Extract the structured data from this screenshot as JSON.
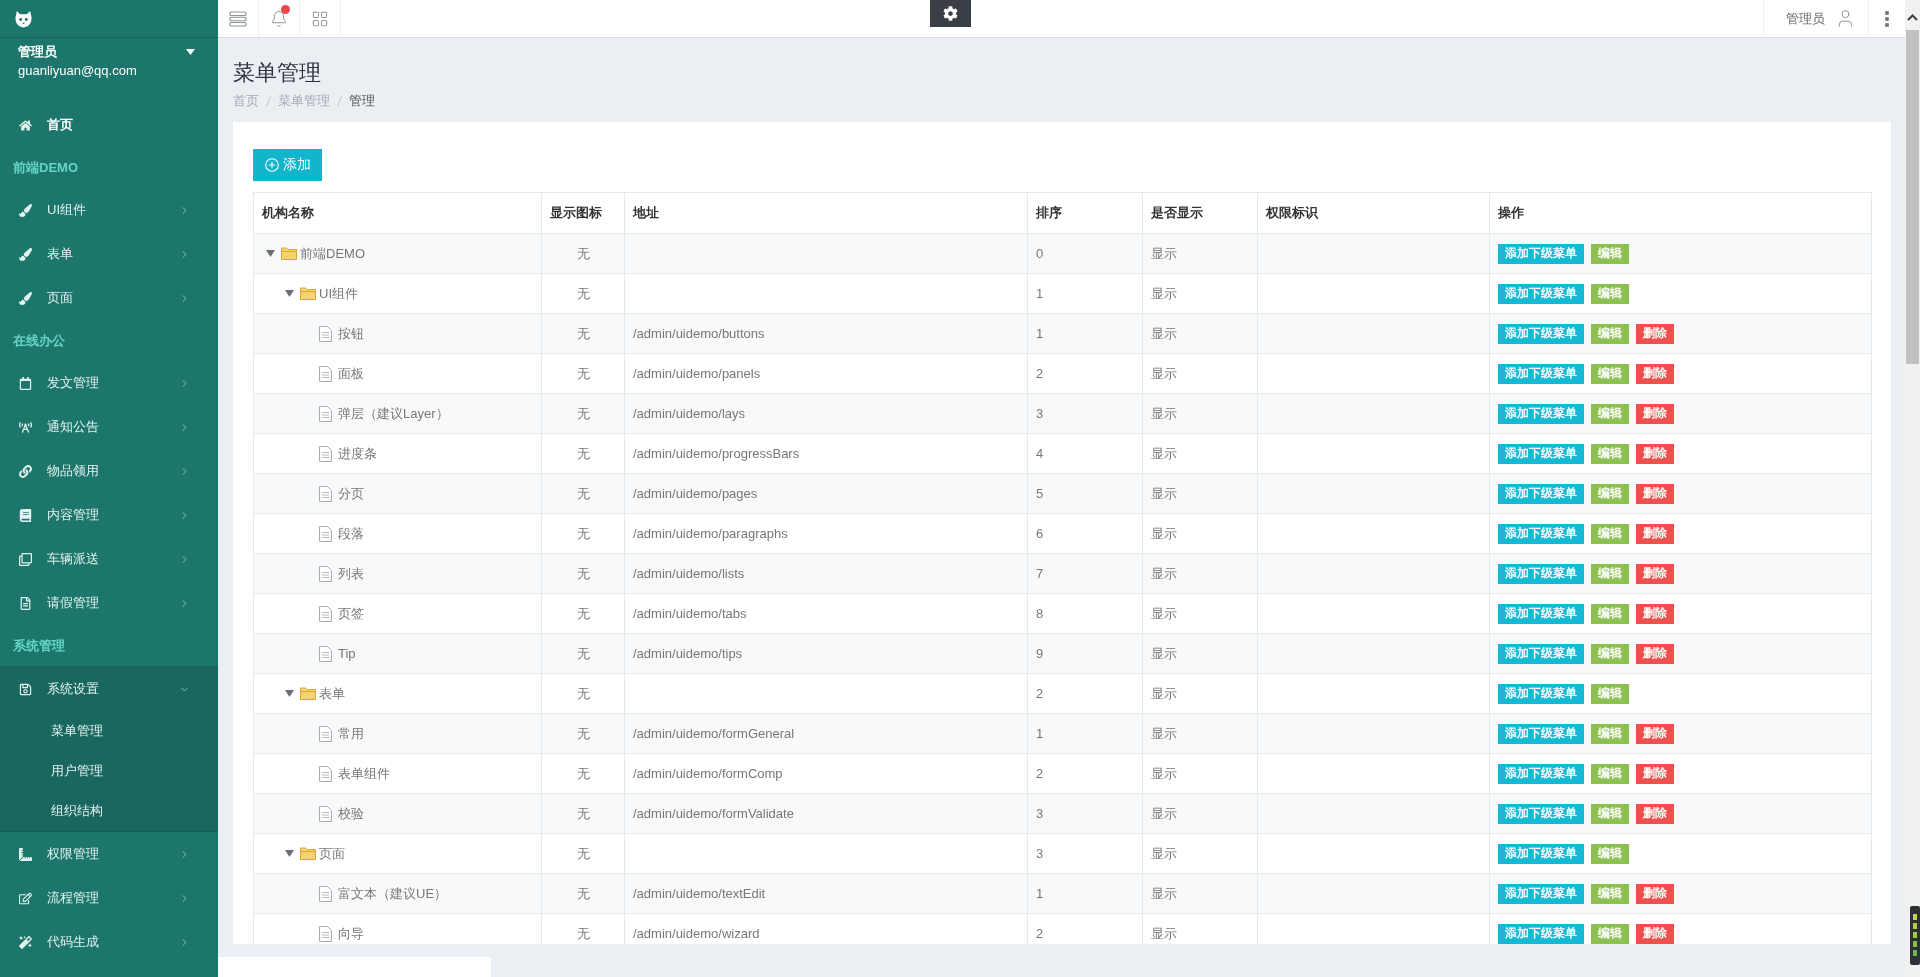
{
  "sidebar": {
    "user": {
      "name": "管理员",
      "email": "guanliyuan@qq.com"
    },
    "nav": [
      {
        "kind": "link",
        "label": "首页"
      },
      {
        "kind": "section",
        "label": "前端DEMO"
      },
      {
        "kind": "menu",
        "label": "UI组件",
        "expanded": false
      },
      {
        "kind": "menu",
        "label": "表单",
        "expanded": false
      },
      {
        "kind": "menu",
        "label": "页面",
        "expanded": false
      },
      {
        "kind": "section",
        "label": "在线办公"
      },
      {
        "kind": "menu",
        "label": "发文管理",
        "expanded": false
      },
      {
        "kind": "menu",
        "label": "通知公告",
        "expanded": false
      },
      {
        "kind": "menu",
        "label": "物品领用",
        "expanded": false
      },
      {
        "kind": "menu",
        "label": "内容管理",
        "expanded": false
      },
      {
        "kind": "menu",
        "label": "车辆派送",
        "expanded": false
      },
      {
        "kind": "menu",
        "label": "请假管理",
        "expanded": false
      },
      {
        "kind": "section",
        "label": "系统管理"
      },
      {
        "kind": "menu",
        "label": "系统设置",
        "expanded": true,
        "children": [
          {
            "label": "菜单管理"
          },
          {
            "label": "用户管理"
          },
          {
            "label": "组织结构"
          }
        ]
      },
      {
        "kind": "menu",
        "label": "权限管理",
        "expanded": false
      },
      {
        "kind": "menu",
        "label": "流程管理",
        "expanded": false
      },
      {
        "kind": "menu",
        "label": "代码生成",
        "expanded": false
      }
    ]
  },
  "topbar": {
    "notifications": {
      "unread": true
    },
    "user": "管理员"
  },
  "page": {
    "title": "菜单管理",
    "breadcrumb": [
      {
        "label": "首页",
        "current": false
      },
      {
        "label": "菜单管理",
        "current": false
      },
      {
        "label": "管理",
        "current": true
      }
    ]
  },
  "toolbar": {
    "add_button": "添加"
  },
  "table": {
    "columns": [
      "机构名称",
      "显示图标",
      "地址",
      "排序",
      "是否显示",
      "权限标识",
      "操作"
    ],
    "rows": [
      {
        "name": "前端DEMO",
        "kind": "folder",
        "expanded": true,
        "display_icon": "无",
        "order": "0",
        "visible": "显示",
        "actions": [
          {
            "kind": "add",
            "label": "添加下级菜单"
          },
          {
            "kind": "edit",
            "label": "编辑"
          }
        ],
        "children": [
          {
            "name": "UI组件",
            "kind": "folder",
            "expanded": true,
            "display_icon": "无",
            "order": "1",
            "visible": "显示",
            "actions": [
              {
                "kind": "add",
                "label": "添加下级菜单"
              },
              {
                "kind": "edit",
                "label": "编辑"
              }
            ],
            "children": [
              {
                "name": "按钮",
                "kind": "page",
                "display_icon": "无",
                "url": "/admin/uidemo/buttons",
                "order": "1",
                "visible": "显示",
                "actions": [
                  {
                    "kind": "add",
                    "label": "添加下级菜单"
                  },
                  {
                    "kind": "edit",
                    "label": "编辑"
                  },
                  {
                    "kind": "delete",
                    "label": "删除"
                  }
                ]
              },
              {
                "name": "面板",
                "kind": "page",
                "display_icon": "无",
                "url": "/admin/uidemo/panels",
                "order": "2",
                "visible": "显示",
                "actions": [
                  {
                    "kind": "add",
                    "label": "添加下级菜单"
                  },
                  {
                    "kind": "edit",
                    "label": "编辑"
                  },
                  {
                    "kind": "delete",
                    "label": "删除"
                  }
                ]
              },
              {
                "name": "弹层（建议Layer）",
                "kind": "page",
                "display_icon": "无",
                "url": "/admin/uidemo/lays",
                "order": "3",
                "visible": "显示",
                "actions": [
                  {
                    "kind": "add",
                    "label": "添加下级菜单"
                  },
                  {
                    "kind": "edit",
                    "label": "编辑"
                  },
                  {
                    "kind": "delete",
                    "label": "删除"
                  }
                ]
              },
              {
                "name": "进度条",
                "kind": "page",
                "display_icon": "无",
                "url": "/admin/uidemo/progressBars",
                "order": "4",
                "visible": "显示",
                "actions": [
                  {
                    "kind": "add",
                    "label": "添加下级菜单"
                  },
                  {
                    "kind": "edit",
                    "label": "编辑"
                  },
                  {
                    "kind": "delete",
                    "label": "删除"
                  }
                ]
              },
              {
                "name": "分页",
                "kind": "page",
                "display_icon": "无",
                "url": "/admin/uidemo/pages",
                "order": "5",
                "visible": "显示",
                "actions": [
                  {
                    "kind": "add",
                    "label": "添加下级菜单"
                  },
                  {
                    "kind": "edit",
                    "label": "编辑"
                  },
                  {
                    "kind": "delete",
                    "label": "删除"
                  }
                ]
              },
              {
                "name": "段落",
                "kind": "page",
                "display_icon": "无",
                "url": "/admin/uidemo/paragraphs",
                "order": "6",
                "visible": "显示",
                "actions": [
                  {
                    "kind": "add",
                    "label": "添加下级菜单"
                  },
                  {
                    "kind": "edit",
                    "label": "编辑"
                  },
                  {
                    "kind": "delete",
                    "label": "删除"
                  }
                ]
              },
              {
                "name": "列表",
                "kind": "page",
                "display_icon": "无",
                "url": "/admin/uidemo/lists",
                "order": "7",
                "visible": "显示",
                "actions": [
                  {
                    "kind": "add",
                    "label": "添加下级菜单"
                  },
                  {
                    "kind": "edit",
                    "label": "编辑"
                  },
                  {
                    "kind": "delete",
                    "label": "删除"
                  }
                ]
              },
              {
                "name": "页签",
                "kind": "page",
                "display_icon": "无",
                "url": "/admin/uidemo/tabs",
                "order": "8",
                "visible": "显示",
                "actions": [
                  {
                    "kind": "add",
                    "label": "添加下级菜单"
                  },
                  {
                    "kind": "edit",
                    "label": "编辑"
                  },
                  {
                    "kind": "delete",
                    "label": "删除"
                  }
                ]
              },
              {
                "name": "Tip",
                "kind": "page",
                "display_icon": "无",
                "url": "/admin/uidemo/tips",
                "order": "9",
                "visible": "显示",
                "actions": [
                  {
                    "kind": "add",
                    "label": "添加下级菜单"
                  },
                  {
                    "kind": "edit",
                    "label": "编辑"
                  },
                  {
                    "kind": "delete",
                    "label": "删除"
                  }
                ]
              }
            ]
          },
          {
            "name": "表单",
            "kind": "folder",
            "expanded": true,
            "display_icon": "无",
            "order": "2",
            "visible": "显示",
            "actions": [
              {
                "kind": "add",
                "label": "添加下级菜单"
              },
              {
                "kind": "edit",
                "label": "编辑"
              }
            ],
            "children": [
              {
                "name": "常用",
                "kind": "page",
                "display_icon": "无",
                "url": "/admin/uidemo/formGeneral",
                "order": "1",
                "visible": "显示",
                "actions": [
                  {
                    "kind": "add",
                    "label": "添加下级菜单"
                  },
                  {
                    "kind": "edit",
                    "label": "编辑"
                  },
                  {
                    "kind": "delete",
                    "label": "删除"
                  }
                ]
              },
              {
                "name": "表单组件",
                "kind": "page",
                "display_icon": "无",
                "url": "/admin/uidemo/formComp",
                "order": "2",
                "visible": "显示",
                "actions": [
                  {
                    "kind": "add",
                    "label": "添加下级菜单"
                  },
                  {
                    "kind": "edit",
                    "label": "编辑"
                  },
                  {
                    "kind": "delete",
                    "label": "删除"
                  }
                ]
              },
              {
                "name": "校验",
                "kind": "page",
                "display_icon": "无",
                "url": "/admin/uidemo/formValidate",
                "order": "3",
                "visible": "显示",
                "actions": [
                  {
                    "kind": "add",
                    "label": "添加下级菜单"
                  },
                  {
                    "kind": "edit",
                    "label": "编辑"
                  },
                  {
                    "kind": "delete",
                    "label": "删除"
                  }
                ]
              }
            ]
          },
          {
            "name": "页面",
            "kind": "folder",
            "expanded": true,
            "display_icon": "无",
            "order": "3",
            "visible": "显示",
            "actions": [
              {
                "kind": "add",
                "label": "添加下级菜单"
              },
              {
                "kind": "edit",
                "label": "编辑"
              }
            ],
            "children": [
              {
                "name": "富文本（建议UE）",
                "kind": "page",
                "display_icon": "无",
                "url": "/admin/uidemo/textEdit",
                "order": "1",
                "visible": "显示",
                "actions": [
                  {
                    "kind": "add",
                    "label": "添加下级菜单"
                  },
                  {
                    "kind": "edit",
                    "label": "编辑"
                  },
                  {
                    "kind": "delete",
                    "label": "删除"
                  }
                ]
              },
              {
                "name": "向导",
                "kind": "page",
                "display_icon": "无",
                "url": "/admin/uidemo/wizard",
                "order": "2",
                "visible": "显示",
                "actions": [
                  {
                    "kind": "add",
                    "label": "添加下级菜单"
                  },
                  {
                    "kind": "edit",
                    "label": "编辑"
                  },
                  {
                    "kind": "delete",
                    "label": "删除"
                  }
                ]
              }
            ]
          }
        ]
      }
    ]
  }
}
